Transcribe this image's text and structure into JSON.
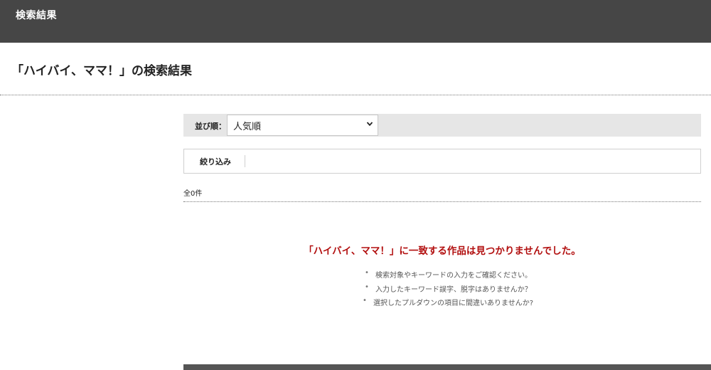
{
  "header": {
    "title": "検索結果"
  },
  "search": {
    "heading": "「ハイバイ、ママ！」の検索結果"
  },
  "sort": {
    "label": "並び順：",
    "selected": "人気順"
  },
  "filter": {
    "label": "絞り込み"
  },
  "results": {
    "count_text": "全0件",
    "no_result_message": "「ハイバイ、ママ！」に一致する作品は見つかりませんでした。",
    "hints": [
      "検索対象やキーワードの入力をご確認ください。",
      "入力したキーワード誤字、脱字はありませんか？",
      "選択したプルダウンの項目に間違いありませんか?"
    ]
  },
  "colors": {
    "header_bg": "#464646",
    "error_text": "#b20f0f",
    "sort_bar_bg": "#e6e6e6"
  },
  "icons": {
    "select_caret": "chevron-down-icon"
  }
}
